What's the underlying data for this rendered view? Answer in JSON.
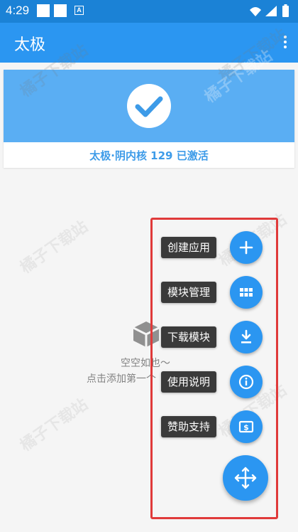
{
  "status_bar": {
    "time": "4:29"
  },
  "app_bar": {
    "title": "太极",
    "menu_icon": "more-vert-icon"
  },
  "status_card": {
    "text": "太极·阴内核 129 已激活",
    "icon": "check-circle-icon",
    "banner_color": "#5aaef3"
  },
  "empty_state": {
    "line1": "空空如也～",
    "line2": "点击添加第一个"
  },
  "fab_menu": {
    "items": [
      {
        "label": "创建应用",
        "icon": "plus-icon"
      },
      {
        "label": "模块管理",
        "icon": "grid-icon"
      },
      {
        "label": "下载模块",
        "icon": "download-icon"
      },
      {
        "label": "使用说明",
        "icon": "info-icon"
      },
      {
        "label": "赞助支持",
        "icon": "money-icon"
      }
    ],
    "main_icon": "move-arrows-icon"
  },
  "watermark": "橘子下载站",
  "colors": {
    "primary": "#2b96f1",
    "status_bar": "#1b82d6",
    "highlight_border": "#e03a3a"
  }
}
